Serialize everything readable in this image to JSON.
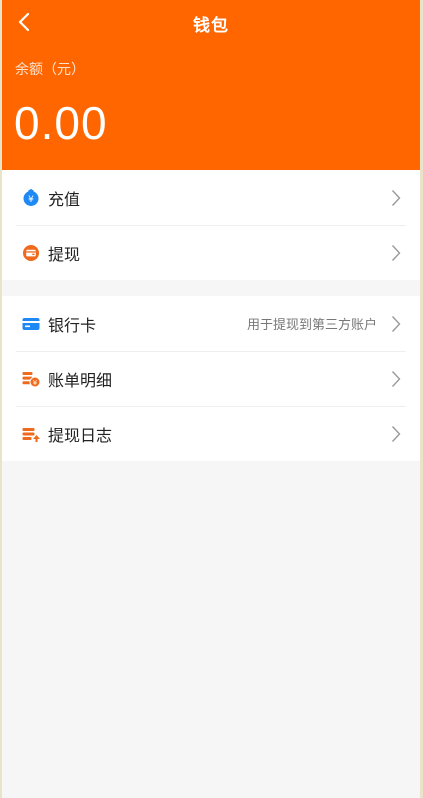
{
  "header": {
    "title": "钱包",
    "balance_label": "余额（元）",
    "balance_value": "0.00"
  },
  "groups": [
    {
      "items": [
        {
          "label": "充值",
          "icon": "recharge-icon"
        },
        {
          "label": "提现",
          "icon": "withdraw-icon"
        }
      ]
    },
    {
      "items": [
        {
          "label": "银行卡",
          "icon": "bank-card-icon",
          "hint": "用于提现到第三方账户"
        },
        {
          "label": "账单明细",
          "icon": "bill-detail-icon"
        },
        {
          "label": "提现日志",
          "icon": "withdraw-log-icon"
        }
      ]
    }
  ],
  "colors": {
    "accent": "#ff6600",
    "blue": "#1e88f5",
    "background": "#f6f6f6"
  }
}
